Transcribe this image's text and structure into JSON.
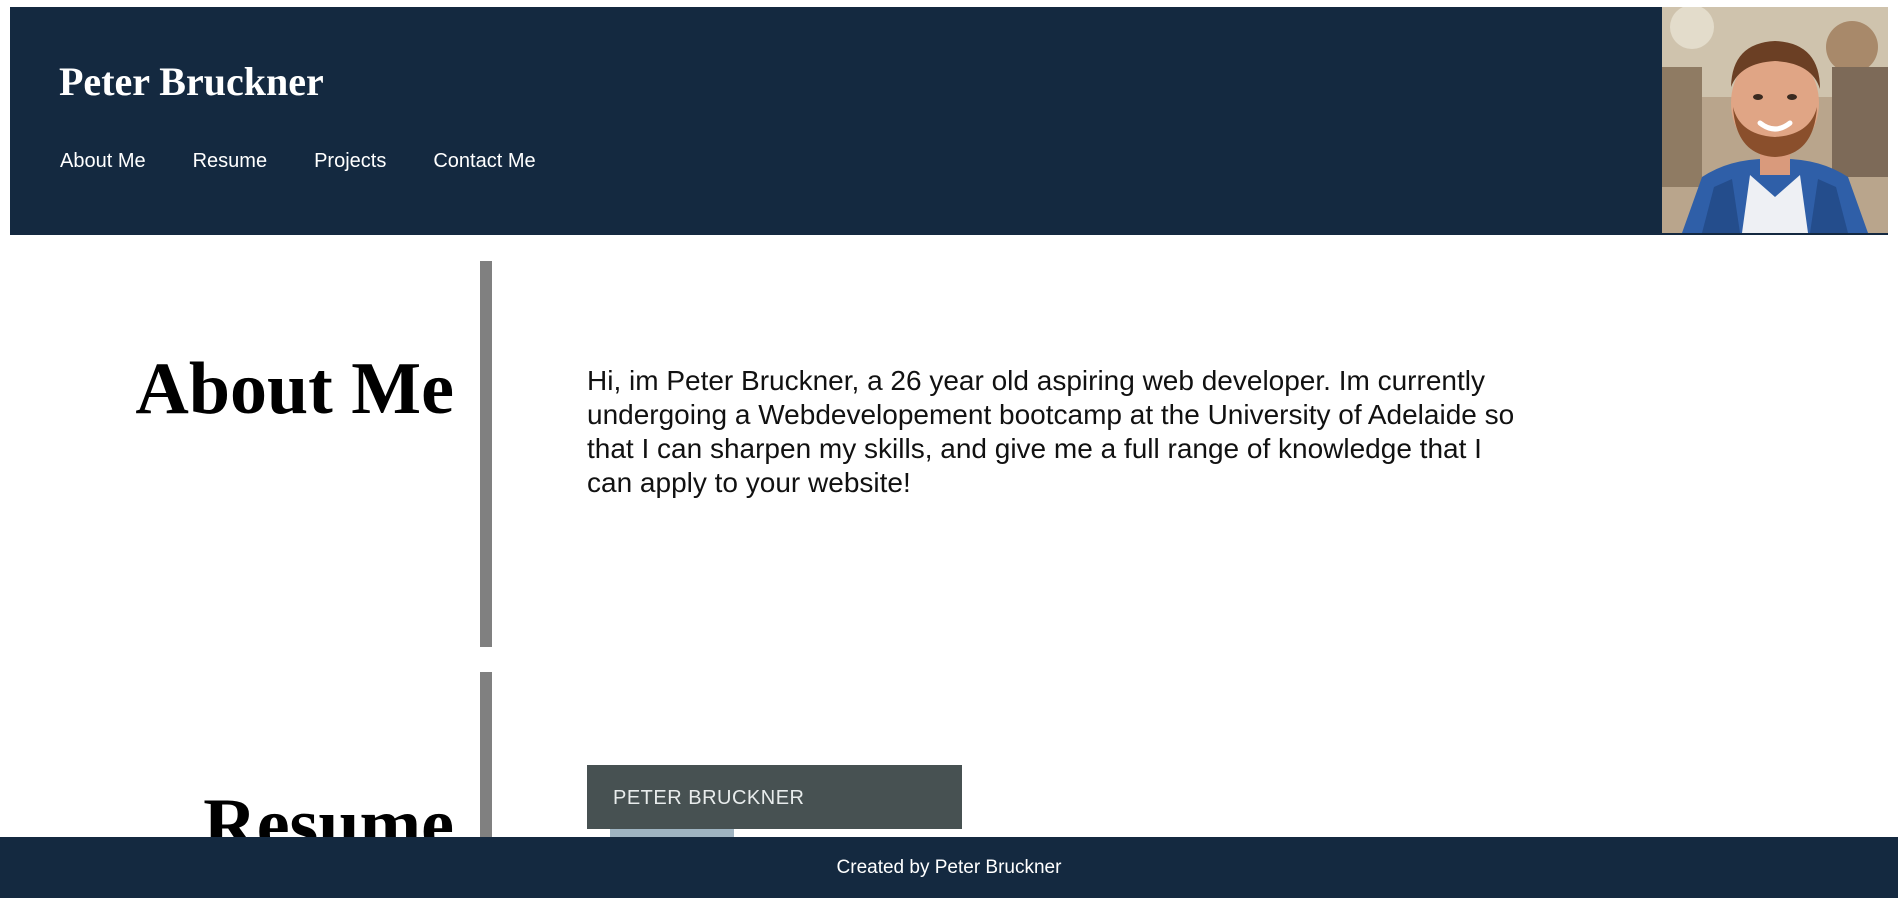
{
  "header": {
    "site_title": "Peter Bruckner",
    "nav": [
      {
        "label": "About Me"
      },
      {
        "label": "Resume"
      },
      {
        "label": "Projects"
      },
      {
        "label": "Contact Me"
      }
    ],
    "background_color": "#142940"
  },
  "about": {
    "heading": "About Me",
    "body": "Hi, im Peter Bruckner, a 26 year old aspiring web developer. Im currently undergoing a Webdevelopement bootcamp at the University of Adelaide so that I can sharpen my skills, and give me a full range of knowledge that I can apply to your website!"
  },
  "resume": {
    "heading": "Resume",
    "card_name": "PETER BRUCKNER",
    "card_color": "#475152"
  },
  "footer": {
    "text": "Created by Peter Bruckner"
  },
  "divider_color": "#808080"
}
